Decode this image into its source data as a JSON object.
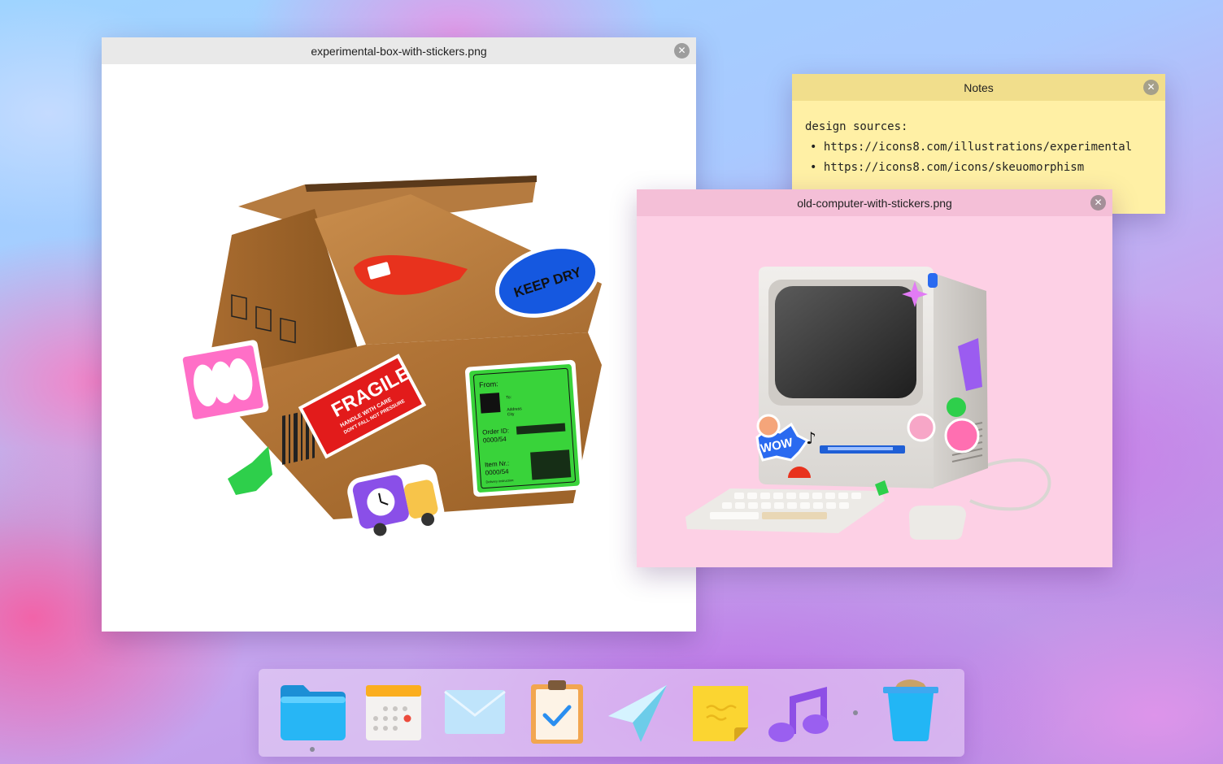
{
  "windows": {
    "box_image": {
      "title": "experimental-box-with-stickers.png",
      "close_label": "✕"
    },
    "notes": {
      "title": "Notes",
      "close_label": "✕",
      "heading": "design sources:",
      "links": [
        "https://icons8.com/illustrations/experimental",
        "https://icons8.com/icons/skeuomorphism"
      ]
    },
    "computer_image": {
      "title": "old-computer-with-stickers.png",
      "close_label": "✕"
    }
  },
  "box_stickers": {
    "fragile": "FRAGILE",
    "handle": "HANDLE WITH CARE",
    "dont_fall": "DON'T FALL NOT PRESSURE",
    "keep_dry": "KEEP DRY",
    "from": "From:",
    "to": "To:",
    "address": "Address",
    "city": "City",
    "order_id": "Order ID:",
    "order_no": "0000/54",
    "item_nr": "Item Nr.:",
    "item_no": "0000/54",
    "delivery": "Delivery instruction:"
  },
  "computer_stickers": {
    "wow": "WOW"
  },
  "dock": {
    "items": [
      {
        "name": "folder",
        "icon": "folder-icon",
        "running": true
      },
      {
        "name": "calendar",
        "icon": "calendar-icon",
        "running": false
      },
      {
        "name": "mail",
        "icon": "mail-icon",
        "running": false
      },
      {
        "name": "tasks",
        "icon": "clipboard-check-icon",
        "running": false
      },
      {
        "name": "send",
        "icon": "paper-plane-icon",
        "running": false
      },
      {
        "name": "notes",
        "icon": "sticky-note-icon",
        "running": true
      },
      {
        "name": "music",
        "icon": "music-note-icon",
        "running": false
      },
      {
        "name": "trash",
        "icon": "trash-icon",
        "running": false
      }
    ]
  },
  "colors": {
    "notes_bg": "#fff0a5",
    "notes_titlebar": "#f1de8c",
    "computer_bg": "#fdd0e5",
    "computer_titlebar": "#f4bfd7",
    "box_titlebar": "#e9e9e9"
  }
}
